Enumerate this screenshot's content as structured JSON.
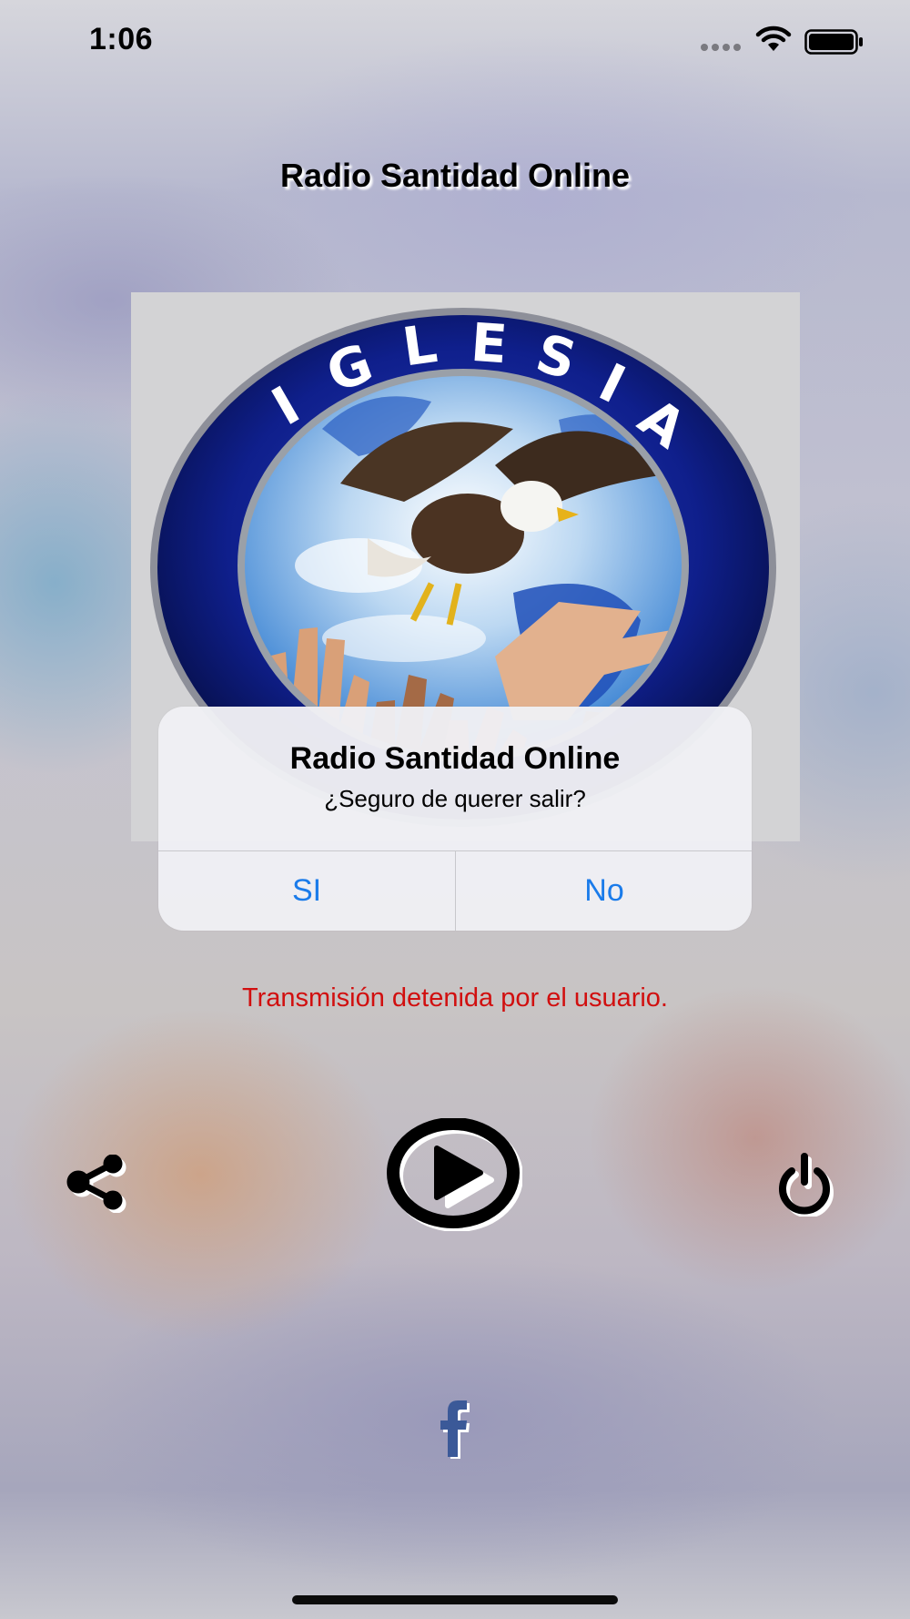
{
  "status_bar": {
    "time": "1:06",
    "icons": [
      "signal-dots-icon",
      "wifi-icon",
      "battery-icon"
    ]
  },
  "app": {
    "title": "Radio Santidad Online"
  },
  "logo": {
    "text_top": "IGLESIA",
    "icon": "eagle-globe-hands-emblem"
  },
  "dialog": {
    "title": "Radio Santidad Online",
    "message": "¿Seguro de querer salir?",
    "confirm_label": "SI",
    "cancel_label": "No"
  },
  "player": {
    "status_message": "Transmisión detenida por el usuario.",
    "share_icon": "share-icon",
    "play_icon": "play-icon",
    "power_icon": "power-icon"
  },
  "footer": {
    "facebook_icon": "facebook-icon"
  },
  "colors": {
    "dialog_button": "#1a7bea",
    "status_message": "#d10f0f",
    "facebook": "#3b5998",
    "logo_ring": "#0c1e86"
  }
}
